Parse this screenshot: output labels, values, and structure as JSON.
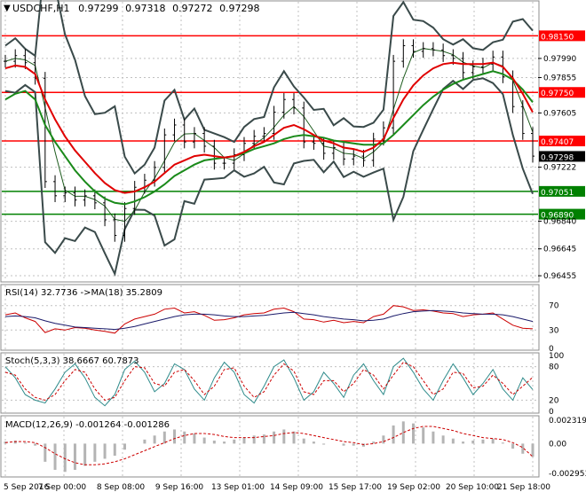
{
  "header": {
    "symbol": "USDCHF,H1",
    "open": "0.97299",
    "high": "0.97318",
    "low": "0.97272",
    "close": "0.97298"
  },
  "colors": {
    "resistance": "#ff0000",
    "support": "#008000",
    "bands": "#3a4a4a",
    "ma_green": "#1a8a1a",
    "ma_red": "#e00000",
    "ma_dark": "#1e5c1e",
    "price": "#000000",
    "rsi_line": "#cc0000",
    "rsi_ma": "#1a1a6a",
    "stoch_main": "#2e8b8b",
    "stoch_signal": "#cc0000",
    "macd_hist": "#b4b4b4",
    "macd_signal": "#cc0000"
  },
  "chart_data": [
    {
      "type": "line",
      "panel": "price",
      "ylim": [
        0.96424,
        0.98384
      ],
      "y_ticks": [
        "0.97990",
        "0.97855",
        "0.97605",
        "0.97222",
        "0.96840",
        "0.96645",
        "0.96455"
      ],
      "x_ticks": [
        "5 Sep 2016",
        "7 Sep 00:00",
        "8 Sep 08:00",
        "9 Sep 16:00",
        "13 Sep 01:00",
        "14 Sep 09:00",
        "15 Sep 17:00",
        "19 Sep 02:00",
        "20 Sep 10:00",
        "21 Sep 18:00"
      ],
      "levels": [
        {
          "value": 0.9815,
          "label": "0.98150",
          "kind": "resistance"
        },
        {
          "value": 0.9775,
          "label": "0.97750",
          "kind": "resistance"
        },
        {
          "value": 0.97407,
          "label": "0.97407",
          "kind": "resistance"
        },
        {
          "value": 0.97051,
          "label": "0.97051",
          "kind": "support"
        },
        {
          "value": 0.9689,
          "label": "0.96890",
          "kind": "support"
        }
      ],
      "current_price": "0.97298",
      "close_series": [
        0.9797,
        0.9801,
        0.9796,
        0.9785,
        0.9712,
        0.9702,
        0.9704,
        0.9699,
        0.9702,
        0.9697,
        0.9685,
        0.9674,
        0.9693,
        0.9708,
        0.9713,
        0.9722,
        0.9745,
        0.9752,
        0.974,
        0.9746,
        0.9737,
        0.9725,
        0.9725,
        0.9731,
        0.9739,
        0.9744,
        0.9746,
        0.9761,
        0.977,
        0.9764,
        0.974,
        0.9739,
        0.9732,
        0.9736,
        0.9728,
        0.973,
        0.9727,
        0.9742,
        0.975,
        0.9797,
        0.9808,
        0.9804,
        0.9806,
        0.9805,
        0.9801,
        0.9799,
        0.9789,
        0.9793,
        0.9795,
        0.98,
        0.9786,
        0.9765,
        0.9746,
        0.973
      ],
      "ma_green_series": [
        0.977,
        0.9774,
        0.9776,
        0.977,
        0.9752,
        0.974,
        0.973,
        0.972,
        0.9712,
        0.9705,
        0.97,
        0.9697,
        0.9696,
        0.9698,
        0.9701,
        0.9705,
        0.971,
        0.9716,
        0.972,
        0.9724,
        0.9727,
        0.9728,
        0.9729,
        0.973,
        0.9732,
        0.9735,
        0.9737,
        0.9739,
        0.9742,
        0.9744,
        0.9745,
        0.9744,
        0.9743,
        0.9741,
        0.974,
        0.9739,
        0.9738,
        0.9738,
        0.9739,
        0.9745,
        0.9752,
        0.9759,
        0.9766,
        0.9772,
        0.9777,
        0.9781,
        0.9784,
        0.9786,
        0.9788,
        0.979,
        0.9788,
        0.9784,
        0.9777,
        0.9768
      ],
      "ma_red_series": [
        0.9792,
        0.9794,
        0.9793,
        0.9788,
        0.977,
        0.9756,
        0.9744,
        0.9734,
        0.9726,
        0.9718,
        0.9711,
        0.9706,
        0.9704,
        0.9705,
        0.9708,
        0.9712,
        0.9718,
        0.9724,
        0.9727,
        0.973,
        0.9731,
        0.973,
        0.9729,
        0.973,
        0.9733,
        0.9737,
        0.974,
        0.9745,
        0.975,
        0.9752,
        0.9749,
        0.9745,
        0.9741,
        0.9739,
        0.9736,
        0.9735,
        0.9733,
        0.9736,
        0.9742,
        0.9757,
        0.977,
        0.978,
        0.9787,
        0.9792,
        0.9795,
        0.9796,
        0.9795,
        0.9795,
        0.9795,
        0.9796,
        0.9793,
        0.9785,
        0.9774,
        0.9761
      ]
    },
    {
      "type": "line",
      "panel": "rsi",
      "title": "RSI(14) 32.7736 ->MA(18) 35.2809",
      "ylim": [
        0,
        100
      ],
      "y_ticks": [
        "70",
        "30",
        "0"
      ],
      "series": [
        {
          "values": [
            55,
            58,
            50,
            44,
            26,
            32,
            30,
            34,
            33,
            30,
            28,
            25,
            40,
            48,
            52,
            56,
            64,
            66,
            58,
            60,
            54,
            46,
            47,
            50,
            55,
            57,
            58,
            64,
            66,
            60,
            48,
            47,
            43,
            46,
            42,
            44,
            42,
            52,
            56,
            70,
            68,
            62,
            63,
            61,
            58,
            57,
            52,
            55,
            56,
            58,
            48,
            38,
            33,
            32
          ]
        },
        {
          "values": [
            52,
            53,
            52,
            50,
            45,
            41,
            38,
            35,
            34,
            33,
            32,
            31,
            33,
            36,
            40,
            44,
            48,
            52,
            55,
            56,
            56,
            55,
            53,
            52,
            52,
            53,
            54,
            56,
            58,
            59,
            57,
            55,
            52,
            50,
            48,
            47,
            45,
            46,
            48,
            53,
            57,
            60,
            61,
            62,
            61,
            60,
            58,
            57,
            56,
            56,
            55,
            52,
            48,
            44
          ]
        }
      ]
    },
    {
      "type": "line",
      "panel": "stochastic",
      "title": "Stoch(5,3,3) 38.6667 60.7873",
      "ylim": [
        0,
        100
      ],
      "y_ticks": [
        "100",
        "80",
        "20",
        "0"
      ],
      "series": [
        {
          "values": [
            80,
            60,
            30,
            20,
            15,
            40,
            70,
            85,
            60,
            25,
            10,
            30,
            75,
            90,
            70,
            35,
            50,
            85,
            75,
            40,
            20,
            60,
            88,
            70,
            30,
            15,
            45,
            80,
            92,
            60,
            20,
            35,
            70,
            50,
            25,
            65,
            85,
            55,
            30,
            80,
            95,
            70,
            40,
            20,
            55,
            85,
            60,
            30,
            50,
            75,
            40,
            20,
            60,
            39
          ]
        },
        {
          "values": [
            70,
            65,
            40,
            25,
            20,
            30,
            55,
            75,
            70,
            40,
            20,
            25,
            55,
            80,
            78,
            50,
            45,
            70,
            75,
            55,
            30,
            45,
            75,
            78,
            45,
            25,
            35,
            65,
            85,
            72,
            35,
            30,
            55,
            55,
            35,
            50,
            75,
            65,
            40,
            65,
            88,
            80,
            55,
            30,
            40,
            70,
            68,
            42,
            45,
            65,
            50,
            30,
            45,
            61
          ]
        }
      ]
    },
    {
      "type": "bar",
      "panel": "macd",
      "title": "MACD(12,26,9) -0.001264 -0.001286",
      "y_ticks": [
        "0.002319",
        "0.00",
        "-0.002953"
      ],
      "series": [
        {
          "values": [
            0.0002,
            0.0003,
            0.0001,
            -0.0002,
            -0.0018,
            -0.0026,
            -0.0028,
            -0.0026,
            -0.0022,
            -0.0018,
            -0.0015,
            -0.0012,
            -0.0006,
            0.0,
            0.0004,
            0.0008,
            0.0012,
            0.0014,
            0.0012,
            0.001,
            0.0006,
            0.0003,
            0.0002,
            0.0004,
            0.0006,
            0.0008,
            0.0009,
            0.0012,
            0.0014,
            0.0012,
            0.0005,
            0.0002,
            -0.0001,
            0.0,
            -0.0002,
            -0.0002,
            -0.0003,
            0.0002,
            0.0008,
            0.0018,
            0.0022,
            0.002,
            0.0016,
            0.0012,
            0.0008,
            0.0005,
            0.0002,
            0.0003,
            0.0004,
            0.0005,
            0.0001,
            -0.0005,
            -0.001,
            -0.0013
          ]
        },
        {
          "values": [
            0.0001,
            0.0002,
            0.0002,
            0.0001,
            -0.0004,
            -0.001,
            -0.0015,
            -0.0019,
            -0.0021,
            -0.0021,
            -0.002,
            -0.0018,
            -0.0015,
            -0.0011,
            -0.0007,
            -0.0003,
            0.0001,
            0.0005,
            0.0008,
            0.001,
            0.001,
            0.0009,
            0.0007,
            0.0006,
            0.0006,
            0.0006,
            0.0007,
            0.0008,
            0.001,
            0.0011,
            0.001,
            0.0008,
            0.0006,
            0.0004,
            0.0002,
            0.0001,
            -0.0001,
            0.0,
            0.0002,
            0.0006,
            0.0011,
            0.0015,
            0.0017,
            0.0017,
            0.0015,
            0.0013,
            0.001,
            0.0008,
            0.0006,
            0.0005,
            0.0004,
            0.0001,
            -0.0004,
            -0.0013
          ]
        }
      ]
    }
  ]
}
